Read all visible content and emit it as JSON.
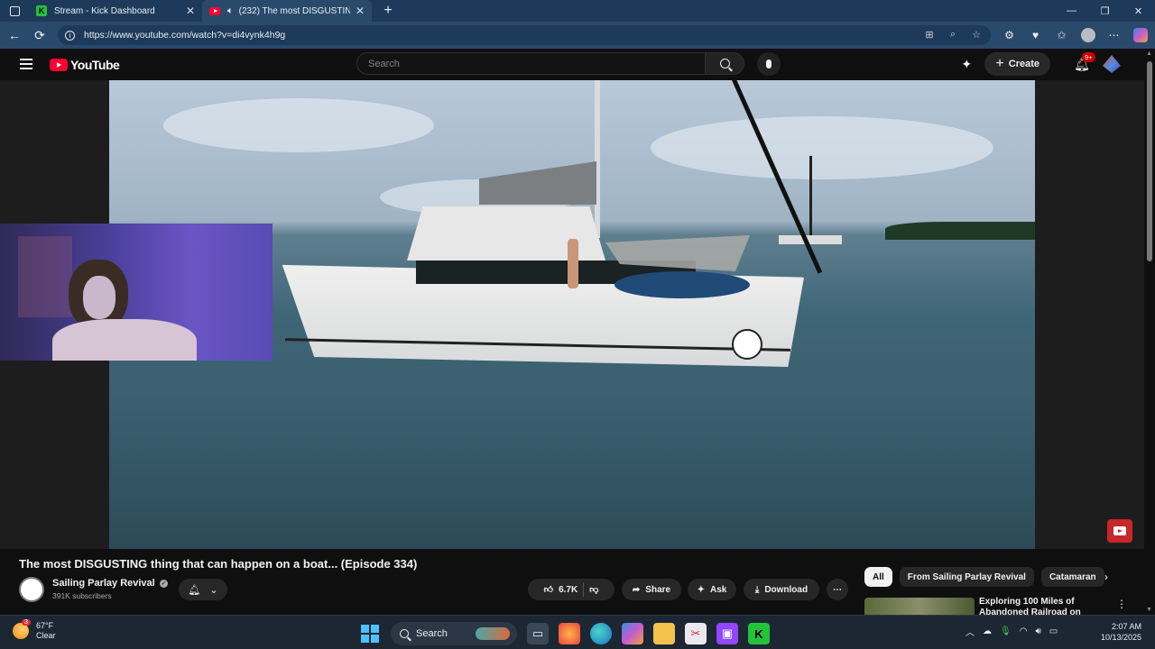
{
  "browser": {
    "tabs": [
      {
        "title": "Stream - Kick Dashboard",
        "favicon": "kick-icon"
      },
      {
        "title": "(232) The most DISGUSTING",
        "favicon": "youtube-icon",
        "audio": true
      }
    ],
    "url": "https://www.youtube.com/watch?v=di4vynk4h9g"
  },
  "youtube": {
    "logo_text": "YouTube",
    "search_placeholder": "Search",
    "create_label": "Create",
    "notifications_badge": "9+"
  },
  "video": {
    "title": "The most DISGUSTING thing that can happen on a boat... (Episode 334)",
    "channel_name": "Sailing Parlay Revival",
    "subscribers": "391K subscribers",
    "likes": "6.7K",
    "share_label": "Share",
    "ask_label": "Ask",
    "download_label": "Download"
  },
  "chips": [
    "All",
    "From Sailing Parlay Revival",
    "Catamaran"
  ],
  "recommendation": {
    "title": "Exploring 100 Miles of Abandoned Railroad on"
  },
  "taskbar": {
    "temperature": "67°F",
    "weather": "Clear",
    "weather_badge": "3",
    "search_label": "Search",
    "time": "2:07 AM",
    "date": "10/13/2025"
  },
  "colors": {
    "tabstrip": "#1e3a5a",
    "youtube_red": "#ff0033",
    "background": "#0f0f0f"
  }
}
